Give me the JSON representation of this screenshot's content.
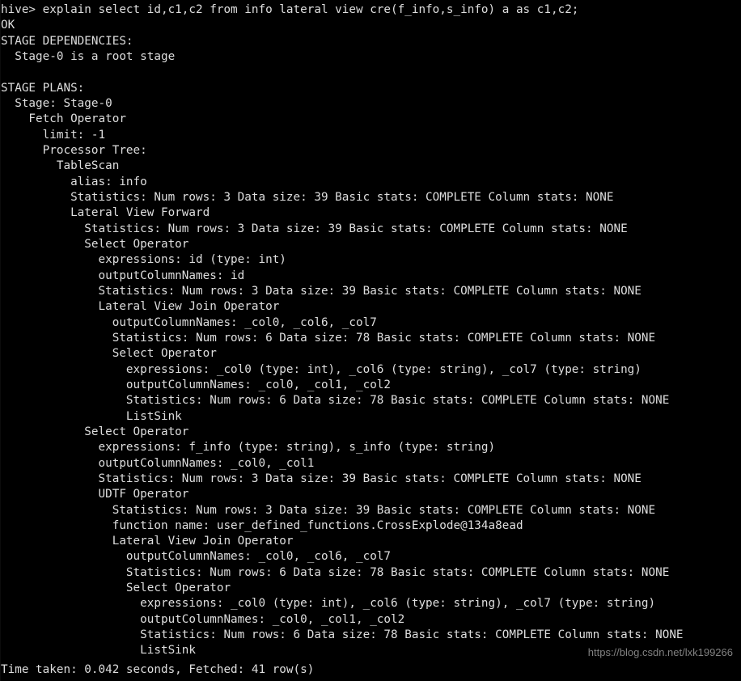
{
  "window": {
    "title": "Hive CLI",
    "background_color": "#000000",
    "foreground_color": "#dedede"
  },
  "terminal": {
    "prompt": "hive>",
    "command": "explain select id,c1,c2 from info lateral view cre(f_info,s_info) a as c1,c2;",
    "prompt_line": "hive> explain select id,c1,c2 from info lateral view cre(f_info,s_info) a as c1,c2;",
    "lines": [
      "hive> explain select id,c1,c2 from info lateral view cre(f_info,s_info) a as c1,c2;",
      "OK",
      "STAGE DEPENDENCIES:",
      "  Stage-0 is a root stage",
      "",
      "STAGE PLANS:",
      "  Stage: Stage-0",
      "    Fetch Operator",
      "      limit: -1",
      "      Processor Tree:",
      "        TableScan",
      "          alias: info",
      "          Statistics: Num rows: 3 Data size: 39 Basic stats: COMPLETE Column stats: NONE",
      "          Lateral View Forward",
      "            Statistics: Num rows: 3 Data size: 39 Basic stats: COMPLETE Column stats: NONE",
      "            Select Operator",
      "              expressions: id (type: int)",
      "              outputColumnNames: id",
      "              Statistics: Num rows: 3 Data size: 39 Basic stats: COMPLETE Column stats: NONE",
      "              Lateral View Join Operator",
      "                outputColumnNames: _col0, _col6, _col7",
      "                Statistics: Num rows: 6 Data size: 78 Basic stats: COMPLETE Column stats: NONE",
      "                Select Operator",
      "                  expressions: _col0 (type: int), _col6 (type: string), _col7 (type: string)",
      "                  outputColumnNames: _col0, _col1, _col2",
      "                  Statistics: Num rows: 6 Data size: 78 Basic stats: COMPLETE Column stats: NONE",
      "                  ListSink",
      "            Select Operator",
      "              expressions: f_info (type: string), s_info (type: string)",
      "              outputColumnNames: _col0, _col1",
      "              Statistics: Num rows: 3 Data size: 39 Basic stats: COMPLETE Column stats: NONE",
      "              UDTF Operator",
      "                Statistics: Num rows: 3 Data size: 39 Basic stats: COMPLETE Column stats: NONE",
      "                function name: user_defined_functions.CrossExplode@134a8ead",
      "                Lateral View Join Operator",
      "                  outputColumnNames: _col0, _col6, _col7",
      "                  Statistics: Num rows: 6 Data size: 78 Basic stats: COMPLETE Column stats: NONE",
      "                  Select Operator",
      "                    expressions: _col0 (type: int), _col6 (type: string), _col7 (type: string)",
      "                    outputColumnNames: _col0, _col1, _col2",
      "                    Statistics: Num rows: 6 Data size: 78 Basic stats: COMPLETE Column stats: NONE",
      "                    ListSink"
    ],
    "status": "Time taken: 0.042 seconds, Fetched: 41 row(s)",
    "status_detail": {
      "time_taken_seconds": "0.042",
      "fetched_rows": "41"
    }
  },
  "plan": {
    "result_status": "OK",
    "stage_dependencies_header": "STAGE DEPENDENCIES:",
    "stage_dependency": "Stage-0 is a root stage",
    "stage_plans_header": "STAGE PLANS:",
    "stage": "Stage: Stage-0",
    "operators": [
      "Fetch Operator",
      "TableScan",
      "Lateral View Forward",
      "Select Operator",
      "Lateral View Join Operator",
      "ListSink",
      "UDTF Operator"
    ],
    "limit": "-1",
    "alias": "info",
    "udtf_function_name": "user_defined_functions.CrossExplode@134a8ead",
    "statistics_3_rows": "Num rows: 3 Data size: 39 Basic stats: COMPLETE Column stats: NONE",
    "statistics_6_rows": "Num rows: 6 Data size: 78 Basic stats: COMPLETE Column stats: NONE"
  },
  "watermark": {
    "text": "https://blog.csdn.net/lxk199266",
    "color": "#8d8d8d"
  }
}
